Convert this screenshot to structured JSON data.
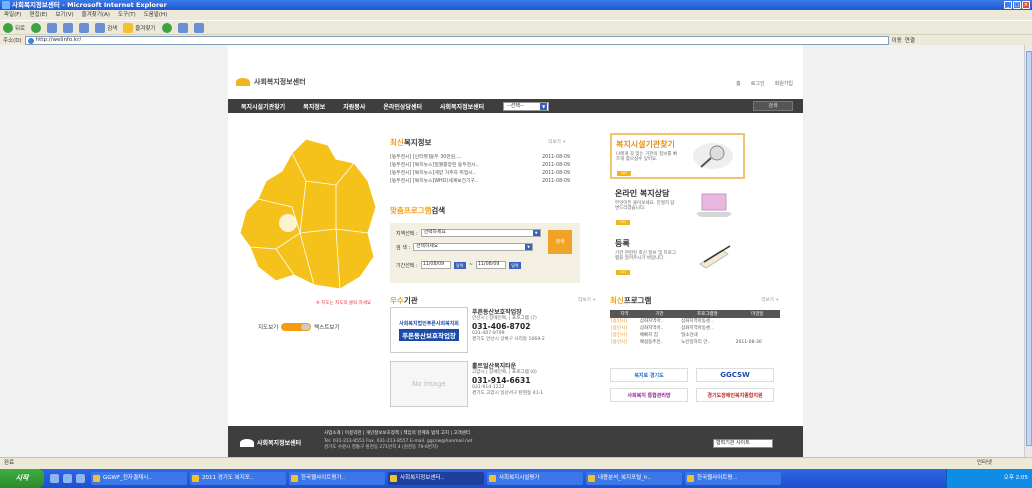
{
  "window": {
    "title": "사회복지정보센터 - Microsoft Internet Explorer"
  },
  "menu": [
    "파일(F)",
    "편집(E)",
    "보기(V)",
    "즐겨찾기(A)",
    "도구(T)",
    "도움말(H)"
  ],
  "toolbar": {
    "back": "뒤로",
    "search": "검색",
    "favorites": "즐겨찾기"
  },
  "address": {
    "label": "주소(D)",
    "url": "http://welinfo.kr/",
    "go": "이동",
    "links": "연결"
  },
  "site": {
    "logo": "사회복지정보센터",
    "toplinks": [
      "홈",
      "로그인",
      "회원가입"
    ],
    "gnb": [
      "복지시설기관찾기",
      "복지정보",
      "자원봉사",
      "온라인상담센터",
      "사회복지정보센터"
    ],
    "gnb_select": "--선택--",
    "gnb_search": "검색",
    "map_note": "※ 지도는 지도의 클릭 하세요",
    "map_toggle_left": "지도보기",
    "map_toggle_right": "텍스트보기",
    "news": {
      "title_a": "최신",
      "title_b": "복지정보",
      "more": "더보기 +",
      "items": [
        {
          "text": "[동두천시] [인터뷰]동두 30만원,...",
          "date": "2011-08-09"
        },
        {
          "text": "[동두천시] [복지뉴스]일월중앙된 동두천시..",
          "date": "2011-08-09"
        },
        {
          "text": "[동두천시] [복지뉴스]게양 거주자 취업시..",
          "date": "2011-08-09"
        },
        {
          "text": "[동두천시] [복지뉴스]WHO(세계보건기구..",
          "date": "2011-08-09"
        }
      ]
    },
    "program": {
      "title_a": "맞춤프로그램",
      "title_b": "검색",
      "region_label": "지역선택 :",
      "region_value": "선택하세요",
      "type_label": "검    색 :",
      "type_value": "선택하세요",
      "date_label": "기간선택 :",
      "date_from": "11/08/09",
      "date_to": "11/08/09",
      "cal": "달력",
      "button": "검색"
    },
    "side": [
      {
        "title": "복지시설기관찾기",
        "desc": "나에게 꼭 맞는 기관의 정보를 빠르게 찾으실수 있어요.",
        "btn": "GO"
      },
      {
        "title": "온라인 복지상담",
        "desc": "무엇이든 물어보세요. 친절히 답변드리겠습니다.",
        "btn": "GO"
      },
      {
        "title": "등록",
        "desc": "기관 관련된 최신 정보 및 프로그램을 알려주시기 바랍니다.",
        "btn": "GO"
      }
    ],
    "excellent": {
      "title_a": "우수",
      "title_b": "기관",
      "more": "더보기 +",
      "items": [
        {
          "name": "푸른동산보호작업장",
          "img_line1": "사회복지법인푸른사회복지회",
          "img_line2": "푸른동산보호작업장",
          "addr": "안산시 | 장애인복, | 프로그램 (7)",
          "phone": "031-406-8702",
          "fax": "031-407-8799",
          "loc": "경기도 안산시 상록구 사리동 1069-2"
        },
        {
          "name": "홀트일산복지타운",
          "img_line1": "No Image",
          "img_line2": "",
          "addr": "고양시 | 장애인복, | 프로그램 (0)",
          "phone": "031-914-6631",
          "fax": "031-914-1222",
          "loc": "경기도 고양시 일산서구 탄현동 41-1"
        }
      ]
    },
    "newprog": {
      "title_a": "최신",
      "title_b": "프로그램",
      "more": "더보기 +",
      "headers": [
        "지역",
        "기관",
        "프로그램명",
        "마감일"
      ],
      "rows": [
        [
          "[용인시]",
          "삼화지역아..",
          "삼화지역아동센..",
          ""
        ],
        [
          "[용인시]",
          "삼화지역아..",
          "삼화지역아동센..",
          ""
        ],
        [
          "[용인시]",
          "예뻐지 집",
          "밀소안내",
          ""
        ],
        [
          "[용인시]",
          "예섬동주민..",
          "노인일자리 안..",
          "2011-08-30"
        ]
      ]
    },
    "banners": [
      "복지로 경기도",
      "GGCSW",
      "사회복지 통합관리망",
      "경기도장애인복지종합지원"
    ],
    "footer": {
      "links": "사업소개  |  이용약관  |  개인정보보호정책  |  책임의 한계와 법적 고지  |  고객센터",
      "addr1": "Tel. 031-213-8551  Fax. 031-213-8557  E-mail. ggcsw@hanmail.net",
      "addr2": "경기도 수원시 영통구 원천동 271번지 4 (원천동 79-6번지)",
      "logo": "사회복지정보센터",
      "select": "협력기관 사이트"
    }
  },
  "status": {
    "left": "완료",
    "zone": "인터넷"
  },
  "taskbar": {
    "start": "시작",
    "tasks": [
      "GGWF_전자결재시..",
      "2011 경기도 복지포..",
      "한국웹사이트평가..",
      "사회복지정보센터..",
      "사회복지시설평가",
      "내용분석_복지포털_h..",
      "한국웹사이트평..."
    ],
    "clock": "오후 2:05"
  }
}
